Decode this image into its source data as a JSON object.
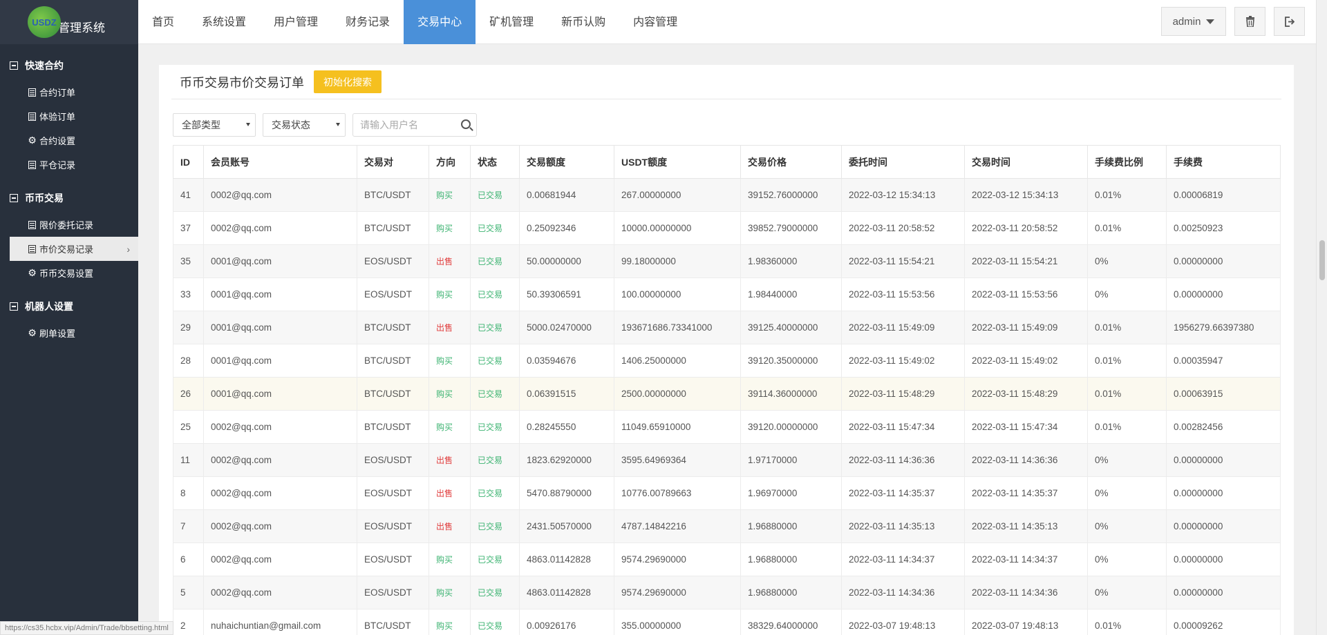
{
  "logo": {
    "mark": "USDZ",
    "title": "管理系统"
  },
  "topnav": {
    "items": [
      "首页",
      "系统设置",
      "用户管理",
      "财务记录",
      "交易中心",
      "矿机管理",
      "新币认购",
      "内容管理"
    ],
    "active_index": 4,
    "user": "admin"
  },
  "sidebar": {
    "groups": [
      {
        "title": "快速合约",
        "items": [
          {
            "label": "合约订单",
            "icon": "doc-icon"
          },
          {
            "label": "体验订单",
            "icon": "doc-icon"
          },
          {
            "label": "合约设置",
            "icon": "gear-icon"
          },
          {
            "label": "平仓记录",
            "icon": "doc-icon"
          }
        ]
      },
      {
        "title": "币币交易",
        "items": [
          {
            "label": "限价委托记录",
            "icon": "doc-icon"
          },
          {
            "label": "市价交易记录",
            "icon": "doc-icon",
            "active": true
          },
          {
            "label": "币币交易设置",
            "icon": "gear-icon"
          }
        ]
      },
      {
        "title": "机器人设置",
        "items": [
          {
            "label": "刷单设置",
            "icon": "gear-icon"
          }
        ]
      }
    ]
  },
  "panel": {
    "title": "币币交易市价交易订单",
    "init_button": "初始化搜索",
    "filter_type": "全部类型",
    "filter_status": "交易状态",
    "search_placeholder": "请输入用户名"
  },
  "table": {
    "headers": [
      "ID",
      "会员账号",
      "交易对",
      "方向",
      "状态",
      "交易额度",
      "USDT额度",
      "交易价格",
      "委托时间",
      "交易时间",
      "手续费比例",
      "手续费"
    ],
    "rows": [
      [
        "41",
        "0002@qq.com",
        "BTC/USDT",
        "购买",
        "已交易",
        "0.00681944",
        "267.00000000",
        "39152.76000000",
        "2022-03-12 15:34:13",
        "2022-03-12 15:34:13",
        "0.01%",
        "0.00006819"
      ],
      [
        "37",
        "0002@qq.com",
        "BTC/USDT",
        "购买",
        "已交易",
        "0.25092346",
        "10000.00000000",
        "39852.79000000",
        "2022-03-11 20:58:52",
        "2022-03-11 20:58:52",
        "0.01%",
        "0.00250923"
      ],
      [
        "35",
        "0001@qq.com",
        "EOS/USDT",
        "出售",
        "已交易",
        "50.00000000",
        "99.18000000",
        "1.98360000",
        "2022-03-11 15:54:21",
        "2022-03-11 15:54:21",
        "0%",
        "0.00000000"
      ],
      [
        "33",
        "0001@qq.com",
        "EOS/USDT",
        "购买",
        "已交易",
        "50.39306591",
        "100.00000000",
        "1.98440000",
        "2022-03-11 15:53:56",
        "2022-03-11 15:53:56",
        "0%",
        "0.00000000"
      ],
      [
        "29",
        "0001@qq.com",
        "BTC/USDT",
        "出售",
        "已交易",
        "5000.02470000",
        "193671686.73341000",
        "39125.40000000",
        "2022-03-11 15:49:09",
        "2022-03-11 15:49:09",
        "0.01%",
        "1956279.66397380"
      ],
      [
        "28",
        "0001@qq.com",
        "BTC/USDT",
        "购买",
        "已交易",
        "0.03594676",
        "1406.25000000",
        "39120.35000000",
        "2022-03-11 15:49:02",
        "2022-03-11 15:49:02",
        "0.01%",
        "0.00035947"
      ],
      [
        "26",
        "0001@qq.com",
        "BTC/USDT",
        "购买",
        "已交易",
        "0.06391515",
        "2500.00000000",
        "39114.36000000",
        "2022-03-11 15:48:29",
        "2022-03-11 15:48:29",
        "0.01%",
        "0.00063915"
      ],
      [
        "25",
        "0002@qq.com",
        "BTC/USDT",
        "购买",
        "已交易",
        "0.28245550",
        "11049.65910000",
        "39120.00000000",
        "2022-03-11 15:47:34",
        "2022-03-11 15:47:34",
        "0.01%",
        "0.00282456"
      ],
      [
        "11",
        "0002@qq.com",
        "EOS/USDT",
        "出售",
        "已交易",
        "1823.62920000",
        "3595.64969364",
        "1.97170000",
        "2022-03-11 14:36:36",
        "2022-03-11 14:36:36",
        "0%",
        "0.00000000"
      ],
      [
        "8",
        "0002@qq.com",
        "EOS/USDT",
        "出售",
        "已交易",
        "5470.88790000",
        "10776.00789663",
        "1.96970000",
        "2022-03-11 14:35:37",
        "2022-03-11 14:35:37",
        "0%",
        "0.00000000"
      ],
      [
        "7",
        "0002@qq.com",
        "EOS/USDT",
        "出售",
        "已交易",
        "2431.50570000",
        "4787.14842216",
        "1.96880000",
        "2022-03-11 14:35:13",
        "2022-03-11 14:35:13",
        "0%",
        "0.00000000"
      ],
      [
        "6",
        "0002@qq.com",
        "EOS/USDT",
        "购买",
        "已交易",
        "4863.01142828",
        "9574.29690000",
        "1.96880000",
        "2022-03-11 14:34:37",
        "2022-03-11 14:34:37",
        "0%",
        "0.00000000"
      ],
      [
        "5",
        "0002@qq.com",
        "EOS/USDT",
        "购买",
        "已交易",
        "4863.01142828",
        "9574.29690000",
        "1.96880000",
        "2022-03-11 14:34:36",
        "2022-03-11 14:34:36",
        "0%",
        "0.00000000"
      ],
      [
        "2",
        "nuhaichuntian@gmail.com",
        "BTC/USDT",
        "购买",
        "已交易",
        "0.00926176",
        "355.00000000",
        "38329.64000000",
        "2022-03-07 19:48:13",
        "2022-03-07 19:48:13",
        "0.01%",
        "0.00009262"
      ]
    ],
    "highlight_row": 6
  },
  "statusbar": {
    "url": "https://cs35.hcbx.vip/Admin/Trade/bbsetting.html"
  },
  "colors": {
    "sidebar_bg": "#28303c",
    "active_tab": "#4a90d9",
    "init_button": "#f5c01f",
    "buy": "#3cb371",
    "sell": "#e03c3c"
  }
}
